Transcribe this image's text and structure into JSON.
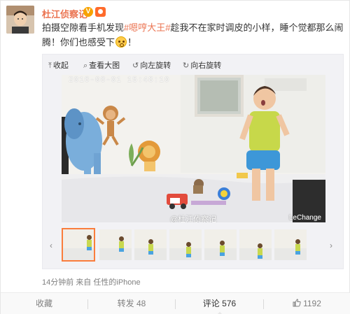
{
  "post": {
    "username": "杜江侦察记",
    "verified_mark": "V",
    "text_before": "拍摄空隙看手机发现",
    "hashtag": "#嗯哼大王#",
    "text_middle": "趁我不在家时调皮的小样，睡个觉都那么闹腾！你们也感受下",
    "text_after": "！"
  },
  "toolbar": {
    "collapse": "收起",
    "view_large": "查看大图",
    "rotate_left": "向左旋转",
    "rotate_right": "向右旋转"
  },
  "photo": {
    "timestamp": "2016-08-01 15:48:10",
    "watermark": "@杜江侦察记",
    "brand": "LeChange"
  },
  "thumbnails": {
    "count": 7,
    "active_index": 0
  },
  "meta": {
    "time": "14分钟前",
    "source_prefix": "来自",
    "source": "任性的iPhone"
  },
  "actions": {
    "favorite": "收藏",
    "repost_label": "转发",
    "repost_count": "48",
    "comment_label": "评论",
    "comment_count": "576",
    "like_count": "1192"
  },
  "colors": {
    "accent": "#eb7350",
    "active_thumb_border": "#fa7d3c",
    "muted_text": "#808080"
  },
  "icons": [
    "collapse-arrow-icon",
    "search-icon",
    "rotate-left-icon",
    "rotate-right-icon",
    "thumb-up-icon",
    "emoji-icon",
    "verified-icon",
    "vip-icon"
  ]
}
